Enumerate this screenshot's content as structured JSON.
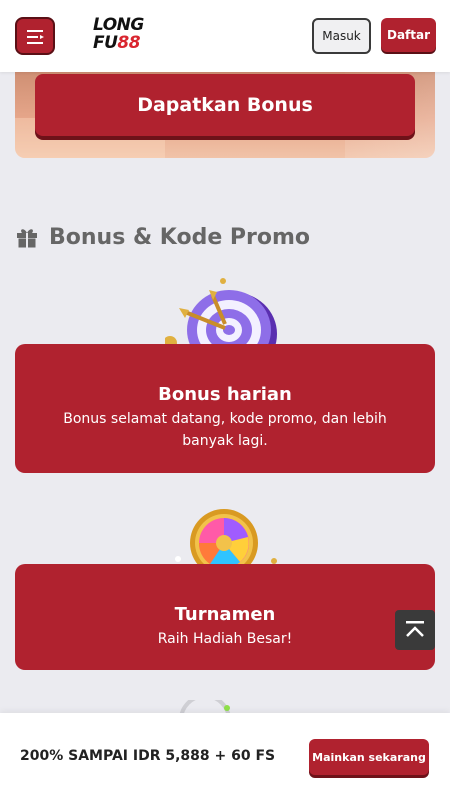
{
  "header": {
    "logo_line1": "LONG",
    "logo_fu": "FU",
    "logo_88": "88",
    "login_label": "Masuk",
    "register_label": "Daftar"
  },
  "hero": {
    "bonus_button_label": "Dapatkan Bonus"
  },
  "section": {
    "title": "Bonus & Kode Promo"
  },
  "cards": [
    {
      "title": "Bonus harian",
      "description": "Bonus selamat datang, kode promo, dan lebih banyak lagi.",
      "illustration": "dart-target-icon"
    },
    {
      "title": "Turnamen",
      "description": "Raih Hadiah Besar!",
      "illustration": "prize-wheel-icon"
    }
  ],
  "bottom_bar": {
    "promo_text": "200% SAMPAI IDR 5,888 + 60 FS",
    "play_button_label": "Mainkan sekarang"
  },
  "colors": {
    "brand_red": "#b0222f",
    "page_bg": "#ebebf0",
    "section_title": "#666666"
  }
}
